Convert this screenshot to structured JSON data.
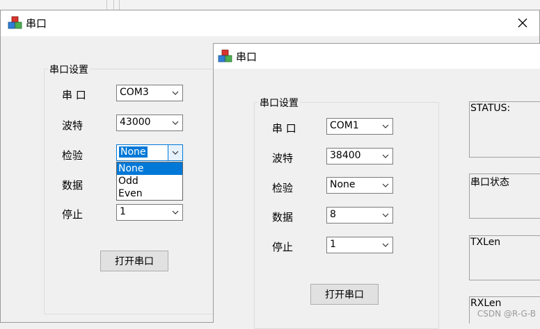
{
  "back_window": {
    "title": "串口",
    "group_title": "串口设置",
    "fields": [
      {
        "label": "串  口",
        "value": "COM3"
      },
      {
        "label": "波特",
        "value": "43000"
      },
      {
        "label": "检验",
        "value": "None"
      },
      {
        "label": "数据",
        "value": ""
      },
      {
        "label": "停止",
        "value": "1"
      }
    ],
    "dropdown_options": [
      "None",
      "Odd",
      "Even"
    ],
    "dropdown_selected": "None",
    "open_button": "打开串口"
  },
  "front_window": {
    "title": "串口",
    "group_title": "串口设置",
    "fields": [
      {
        "label": "串  口",
        "value": "COM1"
      },
      {
        "label": "波特",
        "value": "38400"
      },
      {
        "label": "检验",
        "value": "None"
      },
      {
        "label": "数据",
        "value": "8"
      },
      {
        "label": "停止",
        "value": "1"
      }
    ],
    "open_button": "打开串口",
    "status_panels": [
      {
        "title": "STATUS:"
      },
      {
        "title": "串口状态"
      },
      {
        "title": "TXLen"
      },
      {
        "title": "RXLen"
      }
    ]
  },
  "watermark": "CSDN @R-G-B"
}
